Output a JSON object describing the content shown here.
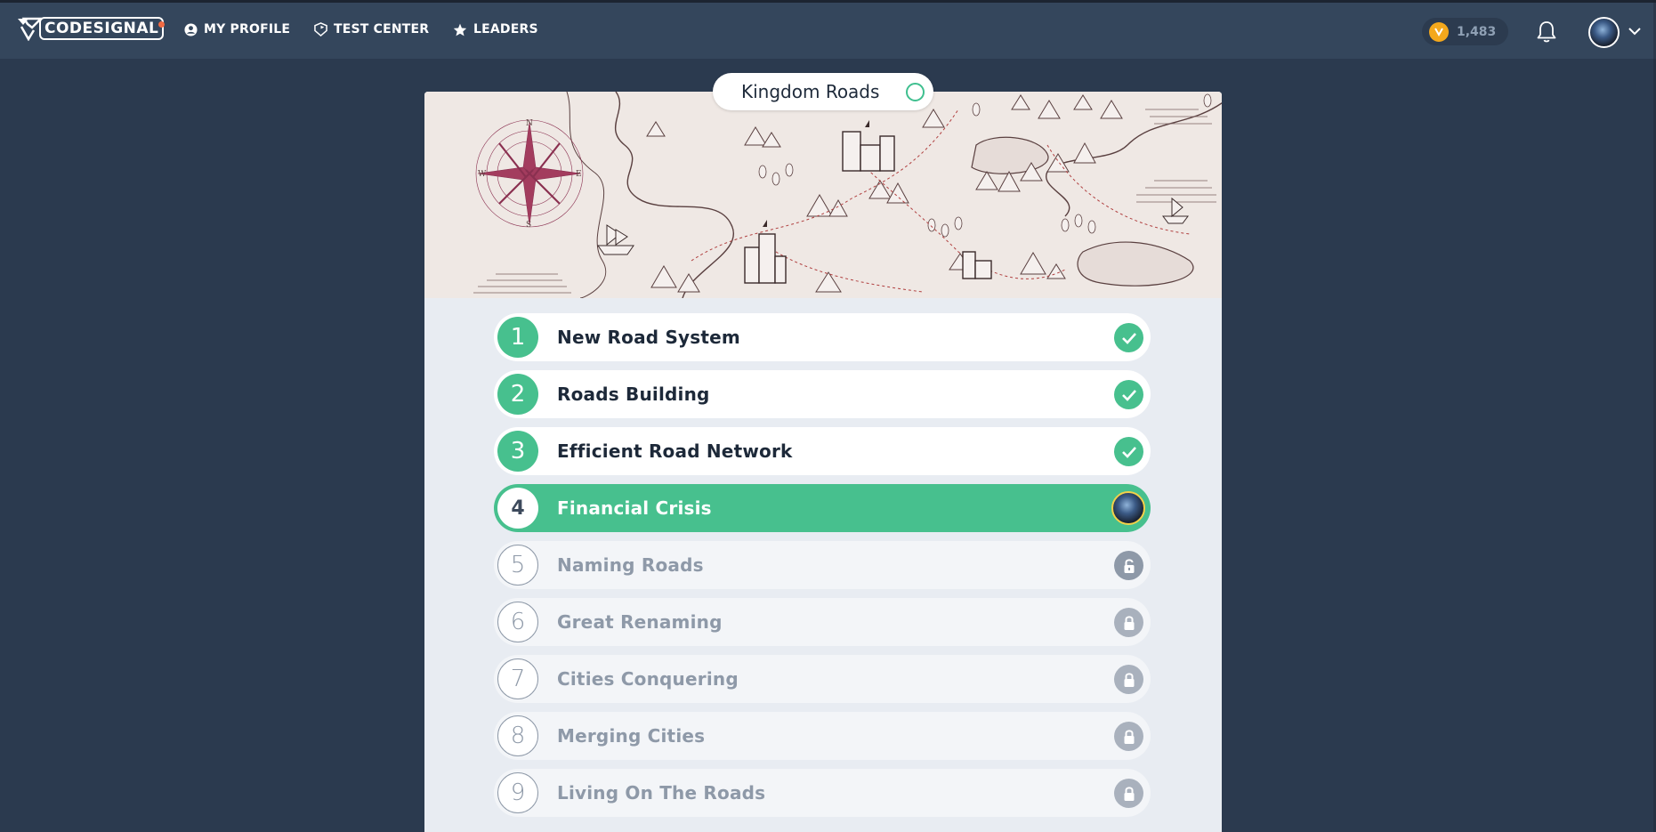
{
  "nav": {
    "logo_text": "CODESIGNAL",
    "items": [
      {
        "label": "MY PROFILE",
        "icon": "user-circle-icon"
      },
      {
        "label": "TEST CENTER",
        "icon": "shield-icon"
      },
      {
        "label": "LEADERS",
        "icon": "star-icon"
      }
    ],
    "coins": "1,483"
  },
  "course": {
    "title": "Kingdom Roads"
  },
  "tasks": [
    {
      "number": "1",
      "title": "New Road System",
      "status": "completed"
    },
    {
      "number": "2",
      "title": "Roads Building",
      "status": "completed"
    },
    {
      "number": "3",
      "title": "Efficient Road Network",
      "status": "completed"
    },
    {
      "number": "4",
      "title": "Financial Crisis",
      "status": "current"
    },
    {
      "number": "5",
      "title": "Naming Roads",
      "status": "unlocked"
    },
    {
      "number": "6",
      "title": "Great Renaming",
      "status": "locked"
    },
    {
      "number": "7",
      "title": "Cities Conquering",
      "status": "locked"
    },
    {
      "number": "8",
      "title": "Merging Cities",
      "status": "locked"
    },
    {
      "number": "9",
      "title": "Living On The Roads",
      "status": "locked"
    }
  ],
  "colors": {
    "background": "#2b3a4f",
    "navbar": "#34465c",
    "accent_green": "#47c08e",
    "locked_gray": "#8e99a8",
    "coin": "#f4a81c"
  }
}
